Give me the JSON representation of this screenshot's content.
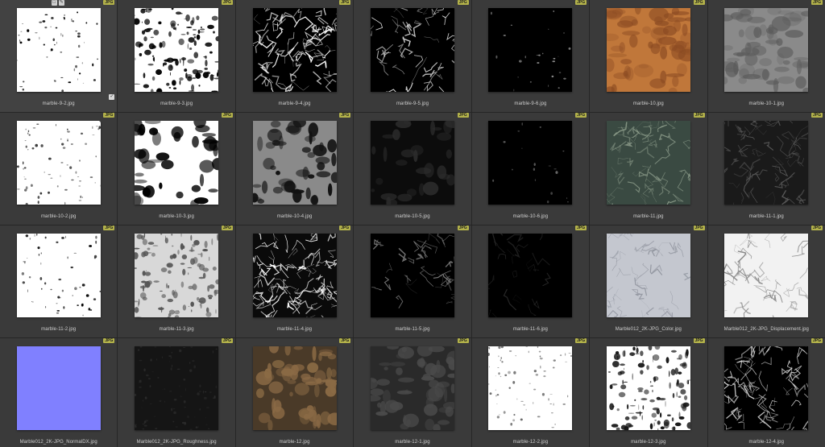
{
  "badge_label": "JPG",
  "items": [
    {
      "name": "marble-9-2.jpg",
      "kind": "speck",
      "bg": "#ffffff",
      "fg": "#000000",
      "density": 60,
      "selected": true
    },
    {
      "name": "marble-9-3.jpg",
      "kind": "heavy",
      "bg": "#ffffff",
      "fg": "#000000",
      "density": 120
    },
    {
      "name": "marble-9-4.jpg",
      "kind": "veins",
      "bg": "#000000",
      "fg": "#ffffff",
      "density": 70
    },
    {
      "name": "marble-9-5.jpg",
      "kind": "veins",
      "bg": "#000000",
      "fg": "#d8d8d8",
      "density": 40
    },
    {
      "name": "marble-9-6.jpg",
      "kind": "speck",
      "bg": "#000000",
      "fg": "#9a9a9a",
      "density": 25
    },
    {
      "name": "marble-10.jpg",
      "kind": "color",
      "bg": "#c0773a",
      "fg": "#8a4a22",
      "density": 60
    },
    {
      "name": "marble-10-1.jpg",
      "kind": "color",
      "bg": "#8a8a8a",
      "fg": "#5a5a5a",
      "density": 60
    },
    {
      "name": "marble-10-2.jpg",
      "kind": "speck",
      "bg": "#ffffff",
      "fg": "#3a3a3a",
      "density": 70
    },
    {
      "name": "marble-10-3.jpg",
      "kind": "blobs",
      "bg": "#ffffff",
      "fg": "#000000",
      "density": 40
    },
    {
      "name": "marble-10-4.jpg",
      "kind": "blobs",
      "bg": "#8a8a8a",
      "fg": "#111111",
      "density": 45
    },
    {
      "name": "marble-10-5.jpg",
      "kind": "blobs",
      "bg": "#0c0c0c",
      "fg": "#2c2c2c",
      "density": 30
    },
    {
      "name": "marble-10-6.jpg",
      "kind": "speck",
      "bg": "#000000",
      "fg": "#6a6a6a",
      "density": 18
    },
    {
      "name": "marble-11.jpg",
      "kind": "veins",
      "bg": "#3a4a42",
      "fg": "#8a9a88",
      "density": 50
    },
    {
      "name": "marble-11-1.jpg",
      "kind": "veins",
      "bg": "#1a1a1a",
      "fg": "#5a5a5a",
      "density": 55
    },
    {
      "name": "marble-11-2.jpg",
      "kind": "speck",
      "bg": "#ffffff",
      "fg": "#000000",
      "density": 55
    },
    {
      "name": "marble-11-3.jpg",
      "kind": "heavy",
      "bg": "#d8d8d8",
      "fg": "#555555",
      "density": 110
    },
    {
      "name": "marble-11-4.jpg",
      "kind": "veins",
      "bg": "#0a0a0a",
      "fg": "#ffffff",
      "density": 75
    },
    {
      "name": "marble-11-5.jpg",
      "kind": "veins",
      "bg": "#000000",
      "fg": "#7a7a7a",
      "density": 30
    },
    {
      "name": "marble-11-6.jpg",
      "kind": "veins",
      "bg": "#000000",
      "fg": "#2e2e2e",
      "density": 20
    },
    {
      "name": "Marble012_2K-JPG_Color.jpg",
      "kind": "veins",
      "bg": "#c4c7cf",
      "fg": "#8e929c",
      "density": 40
    },
    {
      "name": "Marble012_2K-JPG_Displacement.jpg",
      "kind": "veins",
      "bg": "#f2f2f2",
      "fg": "#8a8a8a",
      "density": 40
    },
    {
      "name": "Marble012_2K-JPG_NormalDX.jpg",
      "kind": "flat",
      "bg": "#8080ff",
      "fg": "#8080ff",
      "density": 0
    },
    {
      "name": "Marble012_2K-JPG_Roughness.jpg",
      "kind": "speck",
      "bg": "#151515",
      "fg": "#2a2a2a",
      "density": 90
    },
    {
      "name": "marble-12.jpg",
      "kind": "blobs",
      "bg": "#4a3a28",
      "fg": "#8a6a45",
      "density": 55
    },
    {
      "name": "marble-12-1.jpg",
      "kind": "blobs",
      "bg": "#2a2a2a",
      "fg": "#4a4a4a",
      "density": 55
    },
    {
      "name": "marble-12-2.jpg",
      "kind": "speck",
      "bg": "#ffffff",
      "fg": "#6a6a6a",
      "density": 70
    },
    {
      "name": "marble-12-3.jpg",
      "kind": "heavy",
      "bg": "#ffffff",
      "fg": "#111111",
      "density": 120
    },
    {
      "name": "marble-12-4.jpg",
      "kind": "veins",
      "bg": "#000000",
      "fg": "#e0e0e0",
      "density": 60
    }
  ]
}
